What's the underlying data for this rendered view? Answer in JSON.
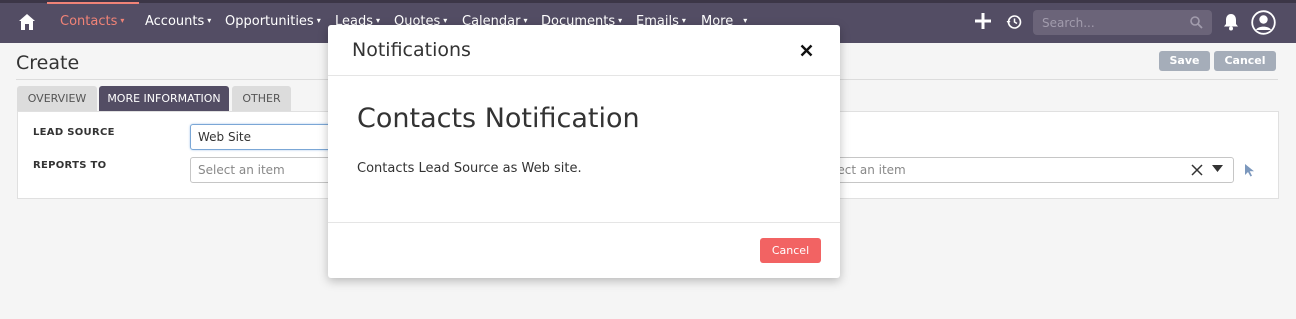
{
  "nav": {
    "items": [
      {
        "label": "Contacts",
        "active": true
      },
      {
        "label": "Accounts"
      },
      {
        "label": "Opportunities"
      },
      {
        "label": "Leads"
      },
      {
        "label": "Quotes"
      },
      {
        "label": "Calendar"
      },
      {
        "label": "Documents"
      },
      {
        "label": "Emails"
      },
      {
        "label": "More"
      }
    ],
    "search_placeholder": "Search...",
    "icons": [
      "home-icon",
      "plus-icon",
      "history-icon",
      "search-icon",
      "bell-icon",
      "user-icon"
    ]
  },
  "page": {
    "title": "Create",
    "save_label": "Save",
    "cancel_label": "Cancel"
  },
  "tabs": [
    {
      "label": "OVERVIEW",
      "active": false
    },
    {
      "label": "MORE INFORMATION",
      "active": true
    },
    {
      "label": "OTHER",
      "active": false
    }
  ],
  "form": {
    "lead_source_label": "LEAD SOURCE",
    "lead_source_value": "Web Site",
    "reports_to_label": "REPORTS TO",
    "reports_to_placeholder": "Select an item",
    "second_select_placeholder": "Select an item"
  },
  "modal": {
    "title": "Notifications",
    "heading": "Contacts Notification",
    "message": "Contacts Lead Source as Web site.",
    "cancel_label": "Cancel"
  },
  "colors": {
    "nav_bg": "#534d64",
    "accent": "#f08377",
    "danger": "#f26363",
    "button_grey": "#a5adb9"
  }
}
